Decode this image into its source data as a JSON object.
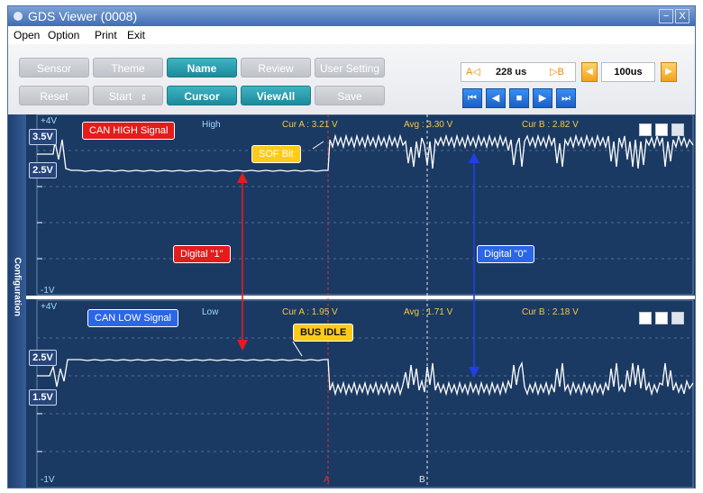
{
  "window": {
    "title": "GDS Viewer (0008)",
    "min_label": "−",
    "close_label": "X"
  },
  "menu": {
    "items": [
      "Open",
      "Option",
      "Print",
      "Exit"
    ]
  },
  "toolbar": {
    "row1": [
      "Sensor",
      "Theme",
      "Name",
      "Review",
      "User Setting"
    ],
    "row2": [
      "Reset",
      "Start",
      "Cursor",
      "ViewAll",
      "Save"
    ],
    "start_arrow": "⇕",
    "cursor_a_label": "A◁",
    "cursor_a_value": "228 us",
    "cursor_b_label": "▷B",
    "timebase_value": "100us",
    "nav_icons": [
      "⏮",
      "◀",
      "■",
      "▶",
      "⏭"
    ]
  },
  "side": {
    "label": "Configuration"
  },
  "scope": {
    "top": {
      "scale_max": "+4V",
      "scale_min": "-1V",
      "tag_high": "3.5V",
      "tag_low": "2.5V",
      "channel_name": "High",
      "cur_a": "Cur A : 3.21 V",
      "avg": "Avg : 3.30 V",
      "cur_b": "Cur B : 2.82 V",
      "signal_label": "CAN HIGH Signal"
    },
    "bottom": {
      "scale_max": "+4V",
      "scale_min": "-1V",
      "tag_high": "2.5V",
      "tag_low": "1.5V",
      "channel_name": "Low",
      "cur_a": "Cur A : 1.95 V",
      "avg": "Avg : 1.71 V",
      "cur_b": "Cur B : 2.18 V",
      "signal_label": "CAN LOW Signal"
    },
    "annotations": {
      "sof": "SOF Bit",
      "bus_idle": "BUS IDLE",
      "digital_1": "Digital  \"1\"",
      "digital_0": "Digital  \"0\""
    },
    "cursor_a": "A",
    "cursor_b": "B",
    "colors": {
      "background": "#1b3a63",
      "trace": "#ffffff",
      "cursor_a": "#e22d2d",
      "cursor_b": "#e8e8e8",
      "arrow_1": "#e41c1c",
      "arrow_0": "#1f3fe8"
    }
  }
}
